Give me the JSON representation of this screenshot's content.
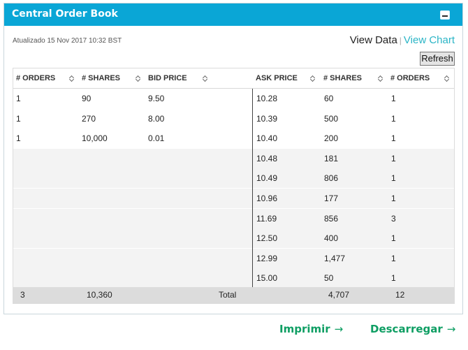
{
  "widget": {
    "title": "Central Order Book",
    "updated": "Atualizado 15 Nov 2017 10:32 BST",
    "view_data": "View Data",
    "separator": "|",
    "view_chart": "View Chart",
    "refresh": "Refresh"
  },
  "table": {
    "columns": [
      "# ORDERS",
      "# SHARES",
      "BID PRICE",
      "ASK PRICE",
      "# SHARES",
      "# ORDERS"
    ],
    "rows": [
      [
        "1",
        "90",
        "9.50",
        "10.28",
        "60",
        "1"
      ],
      [
        "1",
        "270",
        "8.00",
        "10.39",
        "500",
        "1"
      ],
      [
        "1",
        "10,000",
        "0.01",
        "10.40",
        "200",
        "1"
      ],
      [
        "",
        "",
        "",
        "10.48",
        "181",
        "1"
      ],
      [
        "",
        "",
        "",
        "10.49",
        "806",
        "1"
      ],
      [
        "",
        "",
        "",
        "10.96",
        "177",
        "1"
      ],
      [
        "",
        "",
        "",
        "11.69",
        "856",
        "3"
      ],
      [
        "",
        "",
        "",
        "12.50",
        "400",
        "1"
      ],
      [
        "",
        "",
        "",
        "12.99",
        "1,477",
        "1"
      ],
      [
        "",
        "",
        "",
        "15.00",
        "50",
        "1"
      ]
    ],
    "totals": {
      "bid_orders": "3",
      "bid_shares": "10,360",
      "label": "Total",
      "ask_shares": "4,707",
      "ask_orders": "12"
    }
  },
  "actions": {
    "print": "Imprimir",
    "download": "Descarregar"
  },
  "icons": {
    "collapse": "minus-box-icon",
    "sort": "sort-icon",
    "arrow": "arrow-right-icon"
  },
  "colors": {
    "header": "#0aa6d6",
    "accent_link": "#2bb5c6",
    "action": "#0e9e63"
  }
}
